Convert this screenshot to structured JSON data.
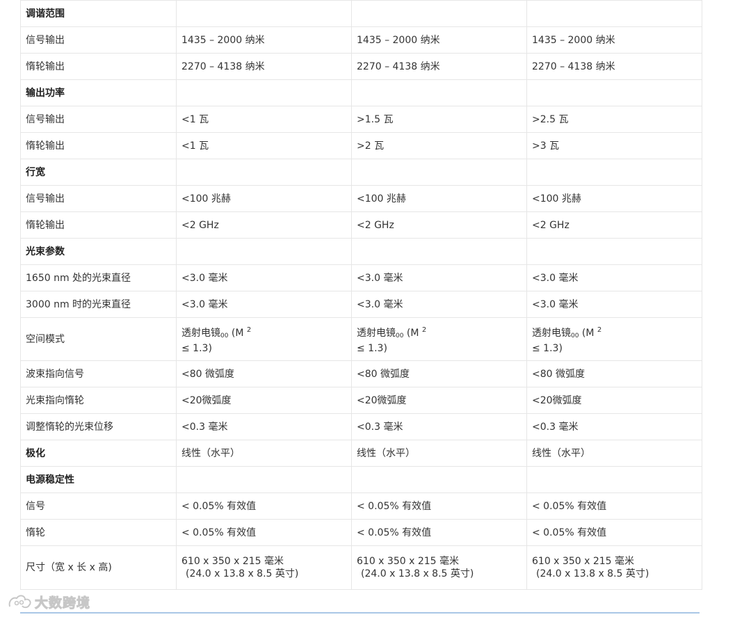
{
  "table": {
    "rows": [
      {
        "type": "section",
        "label": "调谐范围"
      },
      {
        "type": "row",
        "label": "信号输出",
        "values": [
          "1435 – 2000 纳米",
          "1435 – 2000 纳米",
          "1435 – 2000 纳米"
        ]
      },
      {
        "type": "row",
        "label": "惰轮输出",
        "values": [
          "2270 – 4138 纳米",
          "2270 – 4138 纳米",
          "2270 – 4138 纳米"
        ]
      },
      {
        "type": "section",
        "label": "输出功率"
      },
      {
        "type": "row",
        "label": "信号输出",
        "values": [
          "<1 瓦",
          ">1.5 瓦",
          ">2.5 瓦"
        ]
      },
      {
        "type": "row",
        "label": "惰轮输出",
        "values": [
          "<1 瓦",
          ">2 瓦",
          ">3 瓦"
        ]
      },
      {
        "type": "section",
        "label": "行宽"
      },
      {
        "type": "row",
        "label": "信号输出",
        "values": [
          "<100 兆赫",
          "<100 兆赫",
          "<100 兆赫"
        ]
      },
      {
        "type": "row",
        "label": "惰轮输出",
        "values": [
          "<2 GHz",
          "<2 GHz",
          "<2 GHz"
        ]
      },
      {
        "type": "section",
        "label": "光束参数"
      },
      {
        "type": "row",
        "label": "1650 nm 处的光束直径",
        "values": [
          "<3.0 毫米",
          "<3.0 毫米",
          "<3.0 毫米"
        ]
      },
      {
        "type": "row",
        "label": "3000 nm 时的光束直径",
        "values": [
          "<3.0 毫米",
          "<3.0 毫米",
          "<3.0 毫米"
        ]
      },
      {
        "type": "spatial",
        "label": "空间模式",
        "main": "透射电镜",
        "sub": "00",
        "mid": " (M ",
        "sup": "2",
        "second": "≤ 1.3)"
      },
      {
        "type": "row",
        "label": "波束指向信号",
        "values": [
          "<80 微弧度",
          "<80 微弧度",
          "<80 微弧度"
        ]
      },
      {
        "type": "row",
        "label": "光束指向惰轮",
        "values": [
          "<20微弧度",
          "<20微弧度",
          "<20微弧度"
        ]
      },
      {
        "type": "row",
        "label": "调整惰轮的光束位移",
        "values": [
          "<0.3 毫米",
          "<0.3 毫米",
          "<0.3 毫米"
        ]
      },
      {
        "type": "bold",
        "label": "极化",
        "values": [
          "线性（水平）",
          "线性（水平）",
          "线性（水平）"
        ]
      },
      {
        "type": "section",
        "label": "电源稳定性"
      },
      {
        "type": "row",
        "label": "信号",
        "values": [
          "< 0.05% 有效值",
          "< 0.05% 有效值",
          "< 0.05% 有效值"
        ]
      },
      {
        "type": "row",
        "label": "惰轮",
        "values": [
          "< 0.05% 有效值",
          "< 0.05% 有效值",
          "< 0.05% 有效值"
        ]
      },
      {
        "type": "dim",
        "label": "尺寸（宽 x 长 x 高)",
        "line1": "610 x 350 x 215 毫米",
        "line2": "(24.0 x 13.8 x 8.5 英寸)"
      }
    ]
  },
  "watermark": {
    "text": "大数跨境",
    "icon": "watermark-logo-icon"
  },
  "colors": {
    "border": "#e6e6e6",
    "rule": "#a9c7e6",
    "text": "#333333"
  }
}
